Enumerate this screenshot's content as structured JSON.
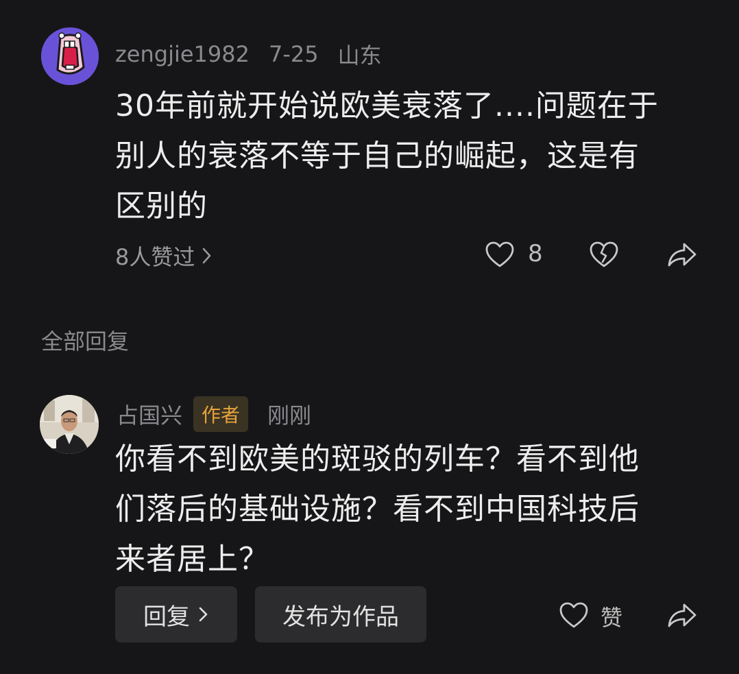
{
  "comment": {
    "username": "zengjie1982",
    "date": "7-25",
    "location": "山东",
    "text_lines": [
      "30年前就开始说欧美衰落了....问题在于",
      "别人的衰落不等于自己的崛起，这是有",
      "区别的"
    ],
    "likers_label": "8人赞过",
    "like_count": "8",
    "icons": {
      "like": "heart-icon",
      "dislike": "broken-heart-icon",
      "share": "share-arrow-icon",
      "chevron": "chevron-right-icon"
    }
  },
  "replies_section": {
    "title": "全部回复"
  },
  "reply": {
    "username": "占国兴",
    "badge": "作者",
    "time": "刚刚",
    "text_lines": [
      "你看不到欧美的斑驳的列车？看不到他",
      "们落后的基础设施？看不到中国科技后",
      "来者居上？"
    ],
    "reply_button": "回复",
    "publish_button": "发布为作品",
    "praise_label": "赞"
  },
  "colors": {
    "background": "#161618",
    "badge_text": "#e8a33c",
    "button_bg": "#2c2c2e"
  }
}
